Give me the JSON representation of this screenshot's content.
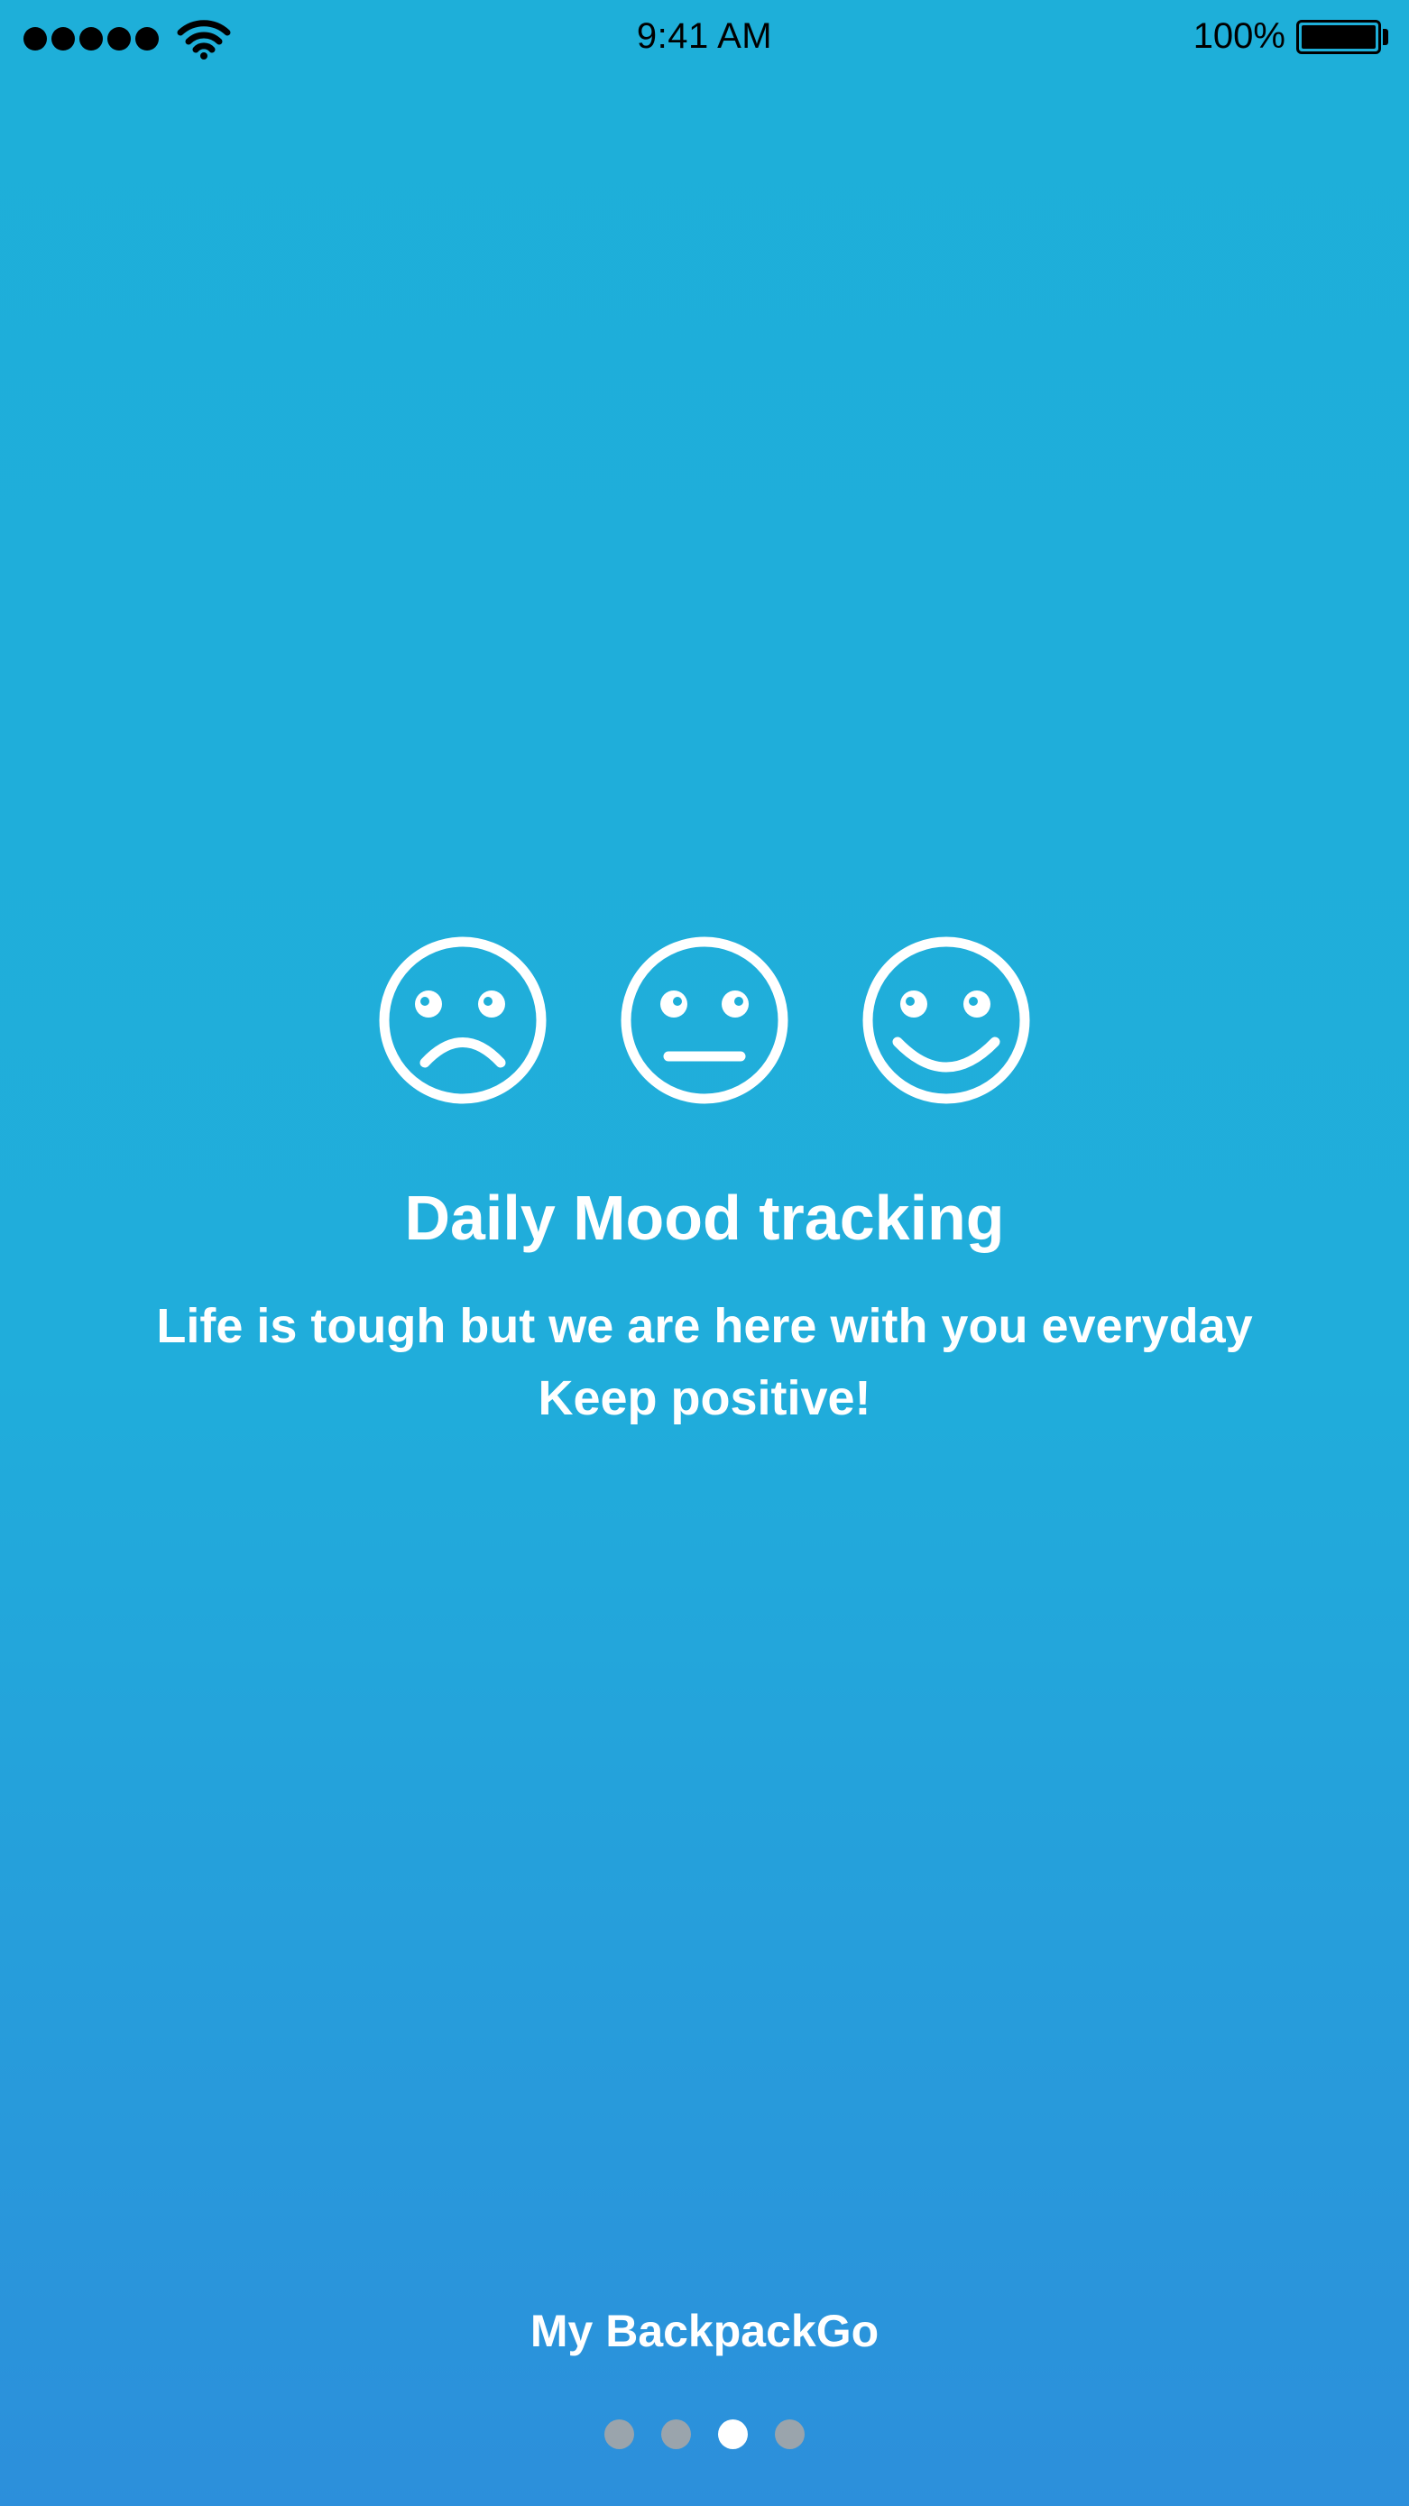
{
  "status_bar": {
    "time": "9:41 AM",
    "battery_percent": "100%",
    "battery_level": 1.0,
    "signal_bars": 5,
    "icons": [
      "signal-icon",
      "wifi-icon",
      "battery-icon"
    ]
  },
  "onboarding": {
    "mood_icons": [
      "sad-face-icon",
      "neutral-face-icon",
      "happy-face-icon"
    ],
    "title": "Daily Mood tracking",
    "subtitle_line1": "Life is tough but we are here with you everyday",
    "subtitle_line2": "Keep positive!",
    "brand": "My BackpackGo",
    "pager": {
      "total": 4,
      "current": 3
    }
  },
  "colors": {
    "background_top": "#1eafd9",
    "background_bottom": "#2c8fdb",
    "foreground": "#ffffff",
    "pager_inactive": "#9aa4ac",
    "pager_active": "#ffffff"
  }
}
